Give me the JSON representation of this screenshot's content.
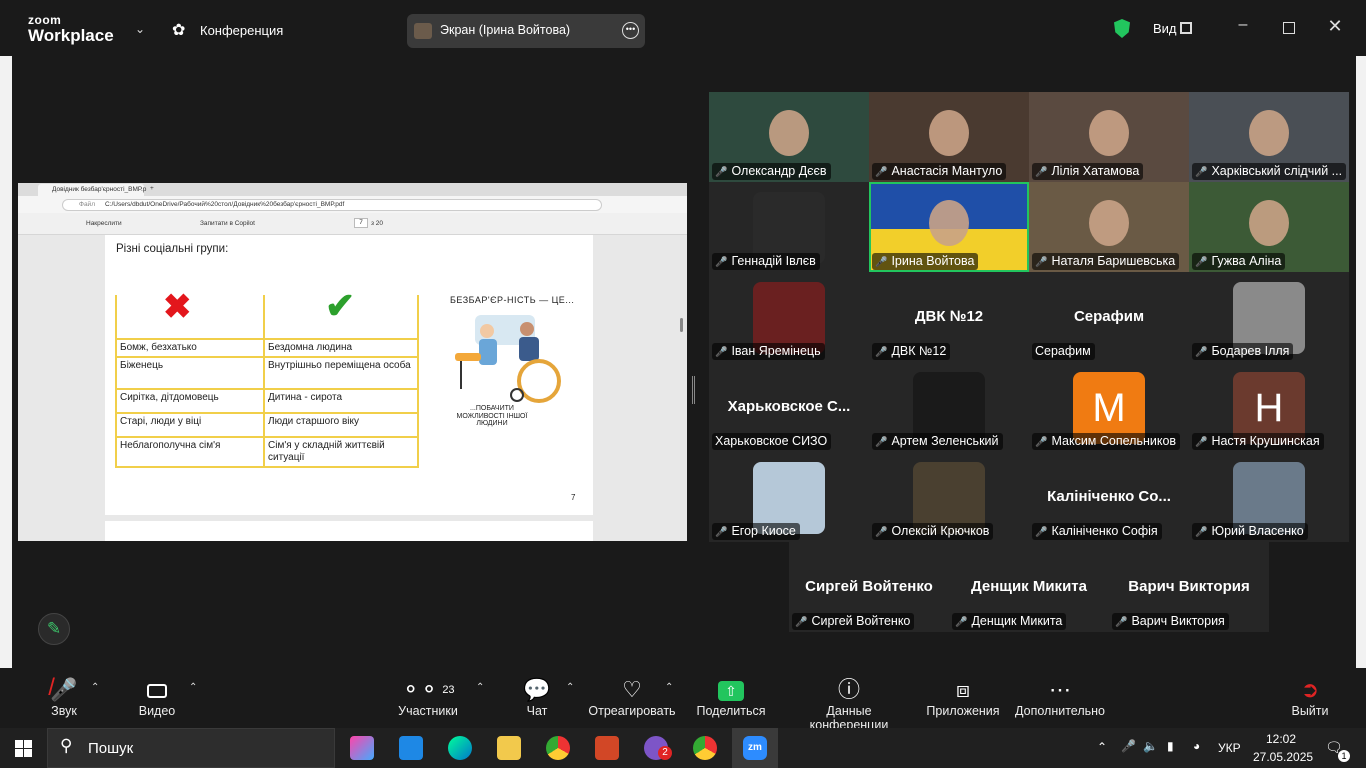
{
  "window": {
    "brand_top": "zoom",
    "brand_bottom": "Workplace",
    "meeting_label": "Конференция",
    "share_label": "Экран (Ірина Войтова)",
    "view_label": "Вид",
    "colors": {
      "bg": "#1a1a1a",
      "shield": "#22c55e",
      "active": "#22c55e",
      "muted": "#e02424"
    }
  },
  "browser": {
    "tab_title": "Довідник безбар'єрності_ВМР.р",
    "url_prefix": "Файл",
    "url": "C:/Users/dbdut/OneDrive/Рабочий%20стол/Довідник%20безбар'єрності_ВМР.pdf",
    "draw_label": "Накреслити",
    "copilot_label": "Запитати в Copilot",
    "page_current": "7",
    "page_total": "з 20"
  },
  "doc": {
    "title": "Різні соціальні групи:",
    "rows": [
      {
        "wrong": "Бомж, безхатько",
        "right": "Бездомна людина"
      },
      {
        "wrong": "Біженець",
        "right": "Внутрішньо переміщена особа"
      },
      {
        "wrong": "Сирітка, дітдомовець",
        "right": "Дитина - сирота"
      },
      {
        "wrong": "Старі, люди у віці",
        "right": "Люди старшого віку"
      },
      {
        "wrong": "Неблагополучна сім'я",
        "right": "Сім'я у складній життєвій ситуації"
      }
    ],
    "ill_title": "БЕЗБАР'ЄР-НІСТЬ — ЦЕ...",
    "ill_sub": "...ПОБАЧИТИ МОЖЛИВОСТІ ІНШОЇ ЛЮДИНИ",
    "page_number": "7"
  },
  "participants": [
    {
      "name": "Олександр Дєєв",
      "type": "video"
    },
    {
      "name": "Анастасія Мантуло",
      "type": "video"
    },
    {
      "name": "Лілія Хатамова",
      "type": "video"
    },
    {
      "name": "Харківський слідчий ...",
      "type": "video"
    },
    {
      "name": "Геннадій Івлєв",
      "type": "avatar"
    },
    {
      "name": "Ірина Войтова",
      "type": "video"
    },
    {
      "name": "Наталя Баришевська",
      "type": "video"
    },
    {
      "name": "Гужва Аліна",
      "type": "video"
    },
    {
      "name": "Іван Яремінець",
      "type": "avatar"
    },
    {
      "name": "ДВК №12",
      "type": "text",
      "big": "ДВК №12"
    },
    {
      "name": "Серафим",
      "type": "text",
      "big": "Серафим"
    },
    {
      "name": "Бодарев Ілля",
      "type": "avatar"
    },
    {
      "name": "Харьковское СИЗО",
      "type": "text",
      "big": "Харьковское С..."
    },
    {
      "name": "Артем Зеленський",
      "type": "avatar"
    },
    {
      "name": "Максим Сопельников",
      "type": "letter",
      "letter": "M"
    },
    {
      "name": "Настя Крушинская",
      "type": "letter",
      "letter": "H"
    },
    {
      "name": "Егор Киосе",
      "type": "avatar"
    },
    {
      "name": "Олексій Крючков",
      "type": "avatar"
    },
    {
      "name": "Калініченко Софія",
      "type": "text",
      "big": "Калініченко Со..."
    },
    {
      "name": "Юрий Власенко",
      "type": "avatar"
    },
    {
      "name": "Сиргей Войтенко",
      "type": "text",
      "big": "Сиргей Войтенко"
    },
    {
      "name": "Денщик Микита",
      "type": "text",
      "big": "Денщик Микита"
    },
    {
      "name": "Варич Виктория",
      "type": "text",
      "big": "Варич Виктория"
    }
  ],
  "toolbar": {
    "audio": "Звук",
    "video": "Видео",
    "participants": "Участники",
    "participants_count": "23",
    "chat": "Чат",
    "react": "Отреагировать",
    "share": "Поделиться",
    "info": "Данные конференции",
    "apps": "Приложения",
    "more": "Дополнительно",
    "leave": "Выйти"
  },
  "taskbar": {
    "search": "Пошук",
    "lang": "УКР",
    "time": "12:02",
    "date": "27.05.2025",
    "viber_badge": "2",
    "notif_badge": "1"
  }
}
